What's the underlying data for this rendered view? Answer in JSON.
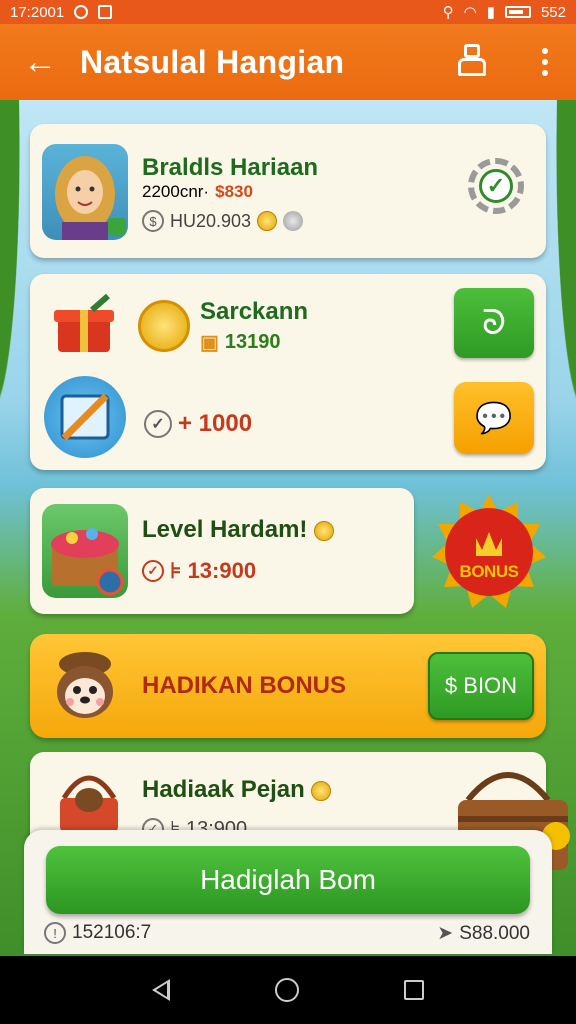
{
  "status_bar": {
    "time": "17:2001",
    "battery": "552"
  },
  "app_bar": {
    "title": "Natsulal Hangian"
  },
  "cards": [
    {
      "title": "Braldls Hariaan",
      "subtitle_prefix": "2200cnr·",
      "subtitle_amount": "$830",
      "detail": "HU20.903"
    },
    {
      "title": "Sarckann",
      "value": "13190",
      "value2": "+ 1000"
    },
    {
      "title": "Level Hardam!",
      "value": "⊧ 13:900",
      "badge": "BONUS"
    }
  ],
  "bonus_bar": {
    "label": "HADIKAN BONUS",
    "button": "$ BION"
  },
  "last_card": {
    "title": "Hadiaak Pejan",
    "value": "⊧ 13:900"
  },
  "bottom": {
    "main_button": "Hadiglah Bom",
    "left_value": "152106:7",
    "right_value": "S88.000"
  },
  "colors": {
    "accent": "#ec6a10",
    "green": "#2f9a24",
    "orange": "#f5a000",
    "red": "#b02a10"
  }
}
